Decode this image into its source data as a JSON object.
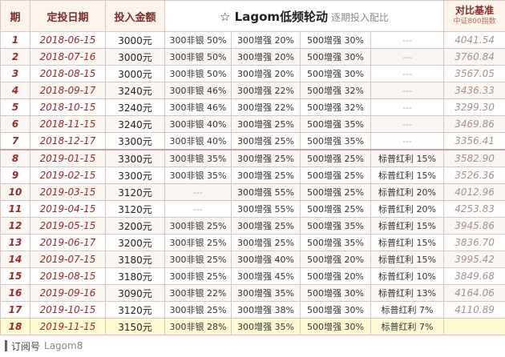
{
  "header": {
    "idx": "期",
    "date": "定投日期",
    "amount": "投入金额",
    "title_main": "☆ Lagom低频轮动",
    "title_sub": "逐期投入配比",
    "bench_top": "对比基准",
    "bench_bottom": "中证800指数"
  },
  "rows": [
    {
      "idx": "1",
      "date": "2018-06-15",
      "amount": "3000元",
      "a1": "300非银 50%",
      "a2": "300增强 20%",
      "a3": "500增强 30%",
      "a4": "---",
      "bench": "4041.54"
    },
    {
      "idx": "2",
      "date": "2018-07-16",
      "amount": "3000元",
      "a1": "300非银 50%",
      "a2": "300增强 20%",
      "a3": "500增强 30%",
      "a4": "---",
      "bench": "3760.84"
    },
    {
      "idx": "3",
      "date": "2018-08-15",
      "amount": "3000元",
      "a1": "300非银 50%",
      "a2": "300增强 20%",
      "a3": "500增强 30%",
      "a4": "---",
      "bench": "3567.05"
    },
    {
      "idx": "4",
      "date": "2018-09-17",
      "amount": "3240元",
      "a1": "300非银 46%",
      "a2": "300增强 22%",
      "a3": "500增强 32%",
      "a4": "---",
      "bench": "3436.33"
    },
    {
      "idx": "5",
      "date": "2018-10-15",
      "amount": "3240元",
      "a1": "300非银 46%",
      "a2": "300增强 22%",
      "a3": "500增强 32%",
      "a4": "---",
      "bench": "3299.30"
    },
    {
      "idx": "6",
      "date": "2018-11-15",
      "amount": "3240元",
      "a1": "300非银 40%",
      "a2": "300增强 25%",
      "a3": "500增强 35%",
      "a4": "---",
      "bench": "3469.86"
    },
    {
      "idx": "7",
      "date": "2018-12-17",
      "amount": "3300元",
      "a1": "300非银 40%",
      "a2": "300增强 25%",
      "a3": "500增强 35%",
      "a4": "---",
      "bench": "3356.41"
    },
    {
      "idx": "8",
      "date": "2019-01-15",
      "amount": "3300元",
      "a1": "300非银 35%",
      "a2": "300增强 25%",
      "a3": "500增强 25%",
      "a4": "标普红利 15%",
      "bench": "3582.90"
    },
    {
      "idx": "9",
      "date": "2019-02-15",
      "amount": "3300元",
      "a1": "300非银 35%",
      "a2": "300增强 25%",
      "a3": "500增强 25%",
      "a4": "标普红利 15%",
      "bench": "3526.36"
    },
    {
      "idx": "10",
      "date": "2019-03-15",
      "amount": "3120元",
      "a1": "---",
      "a2": "300增强 55%",
      "a3": "500增强 25%",
      "a4": "标普红利 20%",
      "bench": "4012.96"
    },
    {
      "idx": "11",
      "date": "2019-04-15",
      "amount": "3120元",
      "a1": "---",
      "a2": "300增强 55%",
      "a3": "500增强 25%",
      "a4": "标普红利 20%",
      "bench": "4253.83"
    },
    {
      "idx": "12",
      "date": "2019-05-15",
      "amount": "3200元",
      "a1": "300非银 25%",
      "a2": "300增强 25%",
      "a3": "500增强 35%",
      "a4": "标普红利 15%",
      "bench": "3945.86"
    },
    {
      "idx": "13",
      "date": "2019-06-17",
      "amount": "3200元",
      "a1": "300非银 25%",
      "a2": "300增强 25%",
      "a3": "500增强 35%",
      "a4": "标普红利 15%",
      "bench": "3836.70"
    },
    {
      "idx": "14",
      "date": "2019-07-15",
      "amount": "3180元",
      "a1": "300非银 25%",
      "a2": "300增强 40%",
      "a3": "500增强 20%",
      "a4": "标普红利 15%",
      "bench": "3995.42"
    },
    {
      "idx": "15",
      "date": "2019-08-15",
      "amount": "3180元",
      "a1": "300非银 25%",
      "a2": "300增强 45%",
      "a3": "500增强 20%",
      "a4": "标普红利 10%",
      "bench": "3849.68"
    },
    {
      "idx": "16",
      "date": "2019-09-16",
      "amount": "3090元",
      "a1": "300非银 22%",
      "a2": "300增强 35%",
      "a3": "500增强 30%",
      "a4": "标普红利 13%",
      "bench": "4164.06"
    },
    {
      "idx": "17",
      "date": "2019-10-15",
      "amount": "3120元",
      "a1": "300非银 25%",
      "a2": "300增强 38%",
      "a3": "500增强 30%",
      "a4": "标普红利 7%",
      "bench": "4110.89"
    },
    {
      "idx": "18",
      "date": "2019-11-15",
      "amount": "3150元",
      "a1": "300非银 28%",
      "a2": "300增强 35%",
      "a3": "500增强 30%",
      "a4": "标普红利 7%",
      "bench": ""
    }
  ],
  "footer": {
    "label": "订阅号",
    "handle": "Lagom8"
  }
}
